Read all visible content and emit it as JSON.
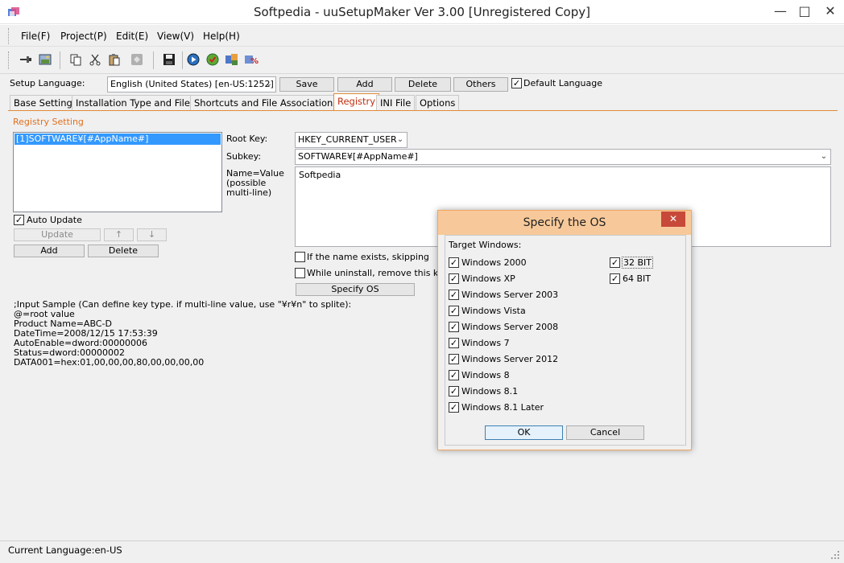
{
  "window": {
    "title": "Softpedia - uuSetupMaker Ver 3.00 [Unregistered Copy]"
  },
  "menu": [
    "File(F)",
    "Project(P)",
    "Edit(E)",
    "View(V)",
    "Help(H)"
  ],
  "setup_language": {
    "label": "Setup Language:",
    "value": "English (United States) [en-US:1252]",
    "save": "Save",
    "add": "Add",
    "delete": "Delete",
    "others": "Others",
    "default_language": "Default Language"
  },
  "tabs": [
    "Base Setting",
    "Installation Type and Files",
    "Shortcuts and File Associations",
    "Registry",
    "INI File",
    "Options"
  ],
  "registry": {
    "section_title": "Registry Setting",
    "list_items": [
      "[1]SOFTWARE¥[#AppName#]"
    ],
    "auto_update": "Auto Update",
    "update": "Update",
    "up": "↑",
    "down": "↓",
    "add": "Add",
    "delete": "Delete",
    "root_key_label": "Root Key:",
    "root_key_value": "HKEY_CURRENT_USER",
    "subkey_label": "Subkey:",
    "subkey_value": "SOFTWARE¥[#AppName#]",
    "name_value_label": [
      "Name=Value",
      "(possible",
      "multi-line)"
    ],
    "name_value_text": "Softpedia",
    "skip_if_exists": "If the name exists, skipping",
    "remove_on_uninstall": "While uninstall, remove this key",
    "specify_os": "Specify OS",
    "input_sample": [
      ";Input Sample (Can define key type. if multi-line value, use \"¥r¥n\" to splite):",
      "@=root value",
      "Product Name=ABC-D",
      "DateTime=2008/12/15 17:53:39",
      "AutoEnable=dword:00000006",
      "Status=dword:00000002",
      "DATA001=hex:01,00,00,00,80,00,00,00,00"
    ]
  },
  "status": {
    "text": "Current Language:en-US"
  },
  "dialog": {
    "title": "Specify the OS",
    "target_label": "Target Windows:",
    "os_list": [
      "Windows 2000",
      "Windows XP",
      "Windows Server 2003",
      "Windows Vista",
      "Windows Server 2008",
      "Windows 7",
      "Windows Server 2012",
      "Windows 8",
      "Windows 8.1",
      "Windows 8.1 Later"
    ],
    "bits": [
      "32 BIT",
      "64 BIT"
    ],
    "ok": "OK",
    "cancel": "Cancel"
  },
  "colors": {
    "accent": "#e08a3a",
    "active_tab_text": "#c03010",
    "selection": "#3399ff",
    "dialog_title": "#f7c99a",
    "close_button": "#c7493a"
  },
  "icons": {
    "window": [
      "minimize-icon",
      "maximize-icon",
      "close-icon"
    ],
    "toolbar": [
      "pin-icon",
      "image-icon",
      "copy-icon",
      "cut-icon",
      "paste-icon",
      "disabled-icon",
      "save-icon",
      "play-icon",
      "check-icon",
      "build-icon",
      "build-alt-icon"
    ]
  }
}
